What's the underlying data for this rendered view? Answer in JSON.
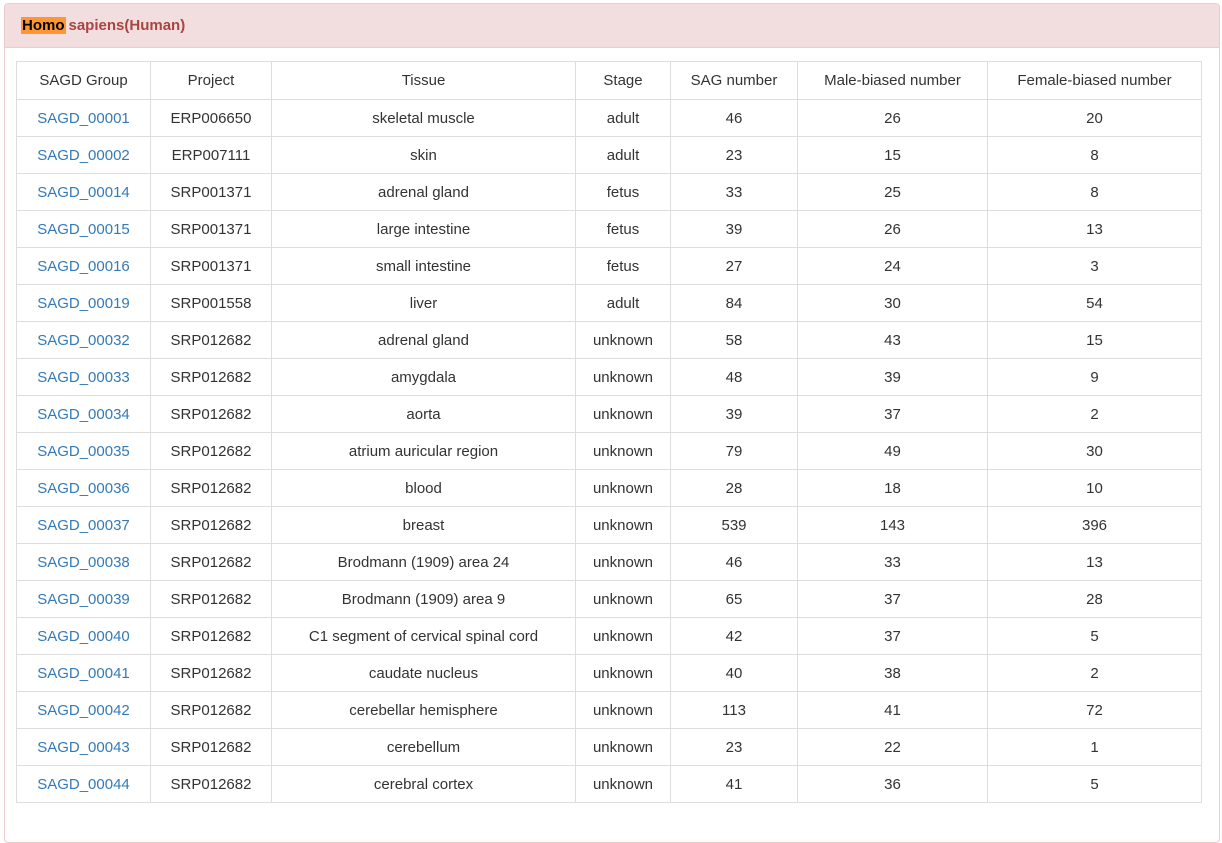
{
  "panel": {
    "title_highlight": "Homo",
    "title_rest": "sapiens(Human)"
  },
  "table": {
    "headers": [
      "SAGD Group",
      "Project",
      "Tissue",
      "Stage",
      "SAG number",
      "Male-biased number",
      "Female-biased number"
    ],
    "rows": [
      [
        "SAGD_00001",
        "ERP006650",
        "skeletal muscle",
        "adult",
        "46",
        "26",
        "20"
      ],
      [
        "SAGD_00002",
        "ERP007111",
        "skin",
        "adult",
        "23",
        "15",
        "8"
      ],
      [
        "SAGD_00014",
        "SRP001371",
        "adrenal gland",
        "fetus",
        "33",
        "25",
        "8"
      ],
      [
        "SAGD_00015",
        "SRP001371",
        "large intestine",
        "fetus",
        "39",
        "26",
        "13"
      ],
      [
        "SAGD_00016",
        "SRP001371",
        "small intestine",
        "fetus",
        "27",
        "24",
        "3"
      ],
      [
        "SAGD_00019",
        "SRP001558",
        "liver",
        "adult",
        "84",
        "30",
        "54"
      ],
      [
        "SAGD_00032",
        "SRP012682",
        "adrenal gland",
        "unknown",
        "58",
        "43",
        "15"
      ],
      [
        "SAGD_00033",
        "SRP012682",
        "amygdala",
        "unknown",
        "48",
        "39",
        "9"
      ],
      [
        "SAGD_00034",
        "SRP012682",
        "aorta",
        "unknown",
        "39",
        "37",
        "2"
      ],
      [
        "SAGD_00035",
        "SRP012682",
        "atrium auricular region",
        "unknown",
        "79",
        "49",
        "30"
      ],
      [
        "SAGD_00036",
        "SRP012682",
        "blood",
        "unknown",
        "28",
        "18",
        "10"
      ],
      [
        "SAGD_00037",
        "SRP012682",
        "breast",
        "unknown",
        "539",
        "143",
        "396"
      ],
      [
        "SAGD_00038",
        "SRP012682",
        "Brodmann (1909) area 24",
        "unknown",
        "46",
        "33",
        "13"
      ],
      [
        "SAGD_00039",
        "SRP012682",
        "Brodmann (1909) area 9",
        "unknown",
        "65",
        "37",
        "28"
      ],
      [
        "SAGD_00040",
        "SRP012682",
        "C1 segment of cervical spinal cord",
        "unknown",
        "42",
        "37",
        "5"
      ],
      [
        "SAGD_00041",
        "SRP012682",
        "caudate nucleus",
        "unknown",
        "40",
        "38",
        "2"
      ],
      [
        "SAGD_00042",
        "SRP012682",
        "cerebellar hemisphere",
        "unknown",
        "113",
        "41",
        "72"
      ],
      [
        "SAGD_00043",
        "SRP012682",
        "cerebellum",
        "unknown",
        "23",
        "22",
        "1"
      ],
      [
        "SAGD_00044",
        "SRP012682",
        "cerebral cortex",
        "unknown",
        "41",
        "36",
        "5"
      ]
    ]
  },
  "colors": {
    "heading_bg": "#f2dede",
    "heading_text": "#a94442",
    "highlight": "#ff9632",
    "link": "#337ab7"
  }
}
